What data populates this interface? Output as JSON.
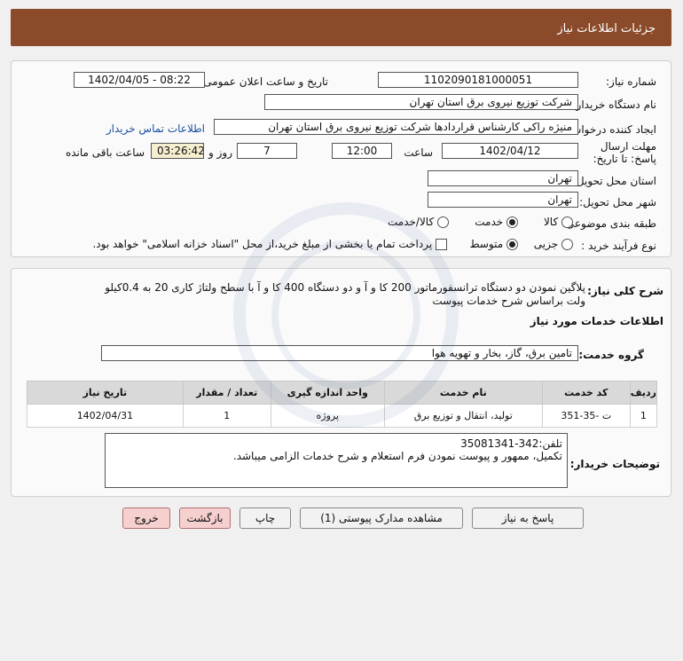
{
  "header": {
    "title": "جزئیات اطلاعات نیاز"
  },
  "info": {
    "need_number_label": "شماره نیاز:",
    "need_number": "1102090181000051",
    "announce_label": "تاریخ و ساعت اعلان عمومی:",
    "announce_value": "1402/04/05 - 08:22",
    "buyer_label": "نام دستگاه خریدار:",
    "buyer_value": "شرکت توزیع نیروی برق استان تهران",
    "creator_label": "ایجاد کننده درخواست:",
    "creator_value": "منیژه راکی کارشناس قراردادها شرکت توزیع نیروی برق استان تهران",
    "contact_link": "اطلاعات تماس خریدار",
    "deadline_label": "مهلت ارسال پاسخ: تا تاریخ:",
    "deadline_date": "1402/04/12",
    "time_label": "ساعت",
    "deadline_time": "12:00",
    "days_value": "7",
    "days_label": "روز و",
    "remaining_value": "03:26:42",
    "remaining_label": "ساعت باقی مانده",
    "province_label": "استان محل تحویل:",
    "province_value": "تهران",
    "city_label": "شهر محل تحویل:",
    "city_value": "تهران",
    "category_label": "طبقه بندی موضوعی:",
    "category_options": [
      "کالا",
      "خدمت",
      "کالا/خدمت"
    ],
    "process_label": "نوع فرآیند خرید :",
    "process_options": [
      "جزیی",
      "متوسط"
    ],
    "payment_note": "پرداخت تمام یا بخشی از مبلغ خرید،از محل \"اسناد خزانه اسلامی\" خواهد بود."
  },
  "summary": {
    "label": "شرح کلی نیاز:",
    "line1": "پلاگین نمودن دو  دستگاه ترانسفورماتور 200 کا و آ و دو  دستگاه 400 کا و آ با سطح ولتاژ کاری 20 به 0.4کیلو",
    "line2": "ولت  براساس شرح خدمات پیوست",
    "services_heading": "اطلاعات خدمات مورد نیاز",
    "group_label": "گروه خدمت:",
    "group_value": "تامین برق، گاز، بخار و تهویه هوا",
    "table_headers": [
      "ردیف",
      "کد خدمت",
      "نام خدمت",
      "واحد اندازه گیری",
      "تعداد / مقدار",
      "تاریخ نیاز"
    ],
    "table_rows": [
      [
        "1",
        "ت -35-351",
        "تولید، انتقال و توزیع برق",
        "پروژه",
        "1",
        "1402/04/31"
      ]
    ],
    "buyer_notes_label": "توضیحات خریدار:",
    "buyer_notes_line1": "تلفن:342-35081341",
    "buyer_notes_line2": "تکمیل، ممهور و پیوست نمودن فرم استعلام و شرح خدمات الزامی میباشد."
  },
  "buttons": {
    "reply": "پاسخ به نیاز",
    "attachments": "مشاهده مدارک پیوستی (1)",
    "print": "چاپ",
    "back": "بازگشت",
    "exit": "خروج"
  }
}
